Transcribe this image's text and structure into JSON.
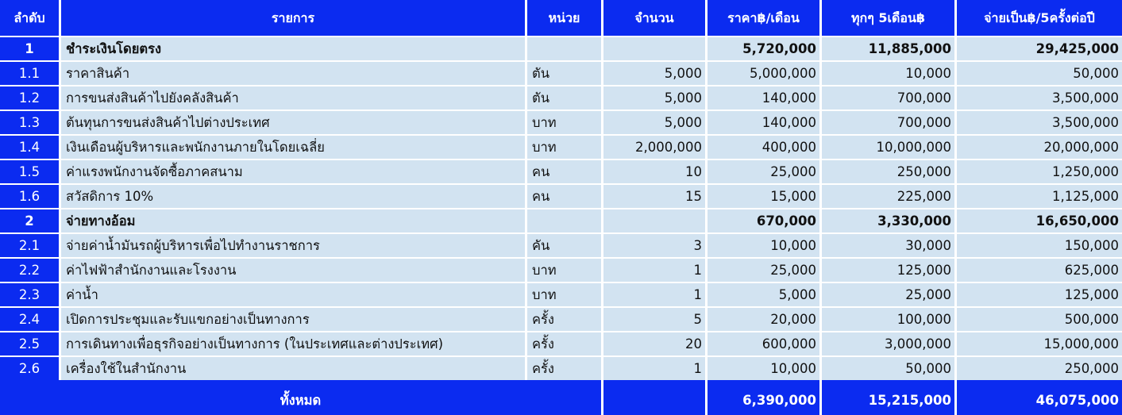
{
  "headers": {
    "seq": "ลำดับ",
    "item": "รายการ",
    "unit": "หน่วย",
    "qty": "จำนวน",
    "price_month": "ราคา฿/เดือน",
    "every5": "ทุกๆ 5เดือน฿",
    "pay5": "จ่ายเป็น฿/5ครั้งต่อปี"
  },
  "rows": [
    {
      "seq": "1",
      "item": "ชำระเงินโดยตรง",
      "unit": "",
      "qty": "",
      "price_month": "5,720,000",
      "every5": "11,885,000",
      "pay5": "29,425,000"
    },
    {
      "seq": "1.1",
      "item": "ราคาสินค้า",
      "unit": "ตัน",
      "qty": "5,000",
      "price_month": "5,000,000",
      "every5": "10,000",
      "pay5": "50,000"
    },
    {
      "seq": "1.2",
      "item": "การขนส่งสินค้าไปยังคลังสินค้า",
      "unit": "ตัน",
      "qty": "5,000",
      "price_month": "140,000",
      "every5": "700,000",
      "pay5": "3,500,000"
    },
    {
      "seq": "1.3",
      "item": "ต้นทุนการขนส่งสินค้าไปต่างประเทศ",
      "unit": "บาท",
      "qty": "5,000",
      "price_month": "140,000",
      "every5": "700,000",
      "pay5": "3,500,000"
    },
    {
      "seq": "1.4",
      "item": "เงินเดือนผู้บริหารและพนักงานภายในโดยเฉลี่ย",
      "unit": "บาท",
      "qty": "2,000,000",
      "price_month": "400,000",
      "every5": "10,000,000",
      "pay5": "20,000,000"
    },
    {
      "seq": "1.5",
      "item": "ค่าแรงพนักงานจัดซื้อภาคสนาม",
      "unit": "คน",
      "qty": "10",
      "price_month": "25,000",
      "every5": "250,000",
      "pay5": "1,250,000"
    },
    {
      "seq": "1.6",
      "item": "สวัสดิการ 10%",
      "unit": "คน",
      "qty": "15",
      "price_month": "15,000",
      "every5": "225,000",
      "pay5": "1,125,000"
    },
    {
      "seq": "2",
      "item": "จ่ายทางอ้อม",
      "unit": "",
      "qty": "",
      "price_month": "670,000",
      "every5": "3,330,000",
      "pay5": "16,650,000"
    },
    {
      "seq": "2.1",
      "item": "จ่ายค่าน้ำมันรถผู้บริหารเพื่อไปทำงานราชการ",
      "unit": "คัน",
      "qty": "3",
      "price_month": "10,000",
      "every5": "30,000",
      "pay5": "150,000"
    },
    {
      "seq": "2.2",
      "item": "ค่าไฟฟ้าสำนักงานและโรงงาน",
      "unit": "บาท",
      "qty": "1",
      "price_month": "25,000",
      "every5": "125,000",
      "pay5": "625,000"
    },
    {
      "seq": "2.3",
      "item": "ค่าน้ำ",
      "unit": "บาท",
      "qty": "1",
      "price_month": "5,000",
      "every5": "25,000",
      "pay5": "125,000"
    },
    {
      "seq": "2.4",
      "item": "เปิดการประชุมและรับแขกอย่างเป็นทางการ",
      "unit": "ครั้ง",
      "qty": "5",
      "price_month": "20,000",
      "every5": "100,000",
      "pay5": "500,000"
    },
    {
      "seq": "2.5",
      "item": "การเดินทางเพื่อธุรกิจอย่างเป็นทางการ (ในประเทศและต่างประเทศ)",
      "unit": "ครั้ง",
      "qty": "20",
      "price_month": "600,000",
      "every5": "3,000,000",
      "pay5": "15,000,000"
    },
    {
      "seq": "2.6",
      "item": "เครื่องใช้ในสำนักงาน",
      "unit": "ครั้ง",
      "qty": "1",
      "price_month": "10,000",
      "every5": "50,000",
      "pay5": "250,000"
    }
  ],
  "total": {
    "label": "ทั้งหมด",
    "price_month": "6,390,000",
    "every5": "15,215,000",
    "pay5": "46,075,000"
  },
  "colors": {
    "header_blue": "#0b2bf0",
    "row_light": "#d2e3f1",
    "text": "#111111",
    "grid": "#ffffff"
  }
}
